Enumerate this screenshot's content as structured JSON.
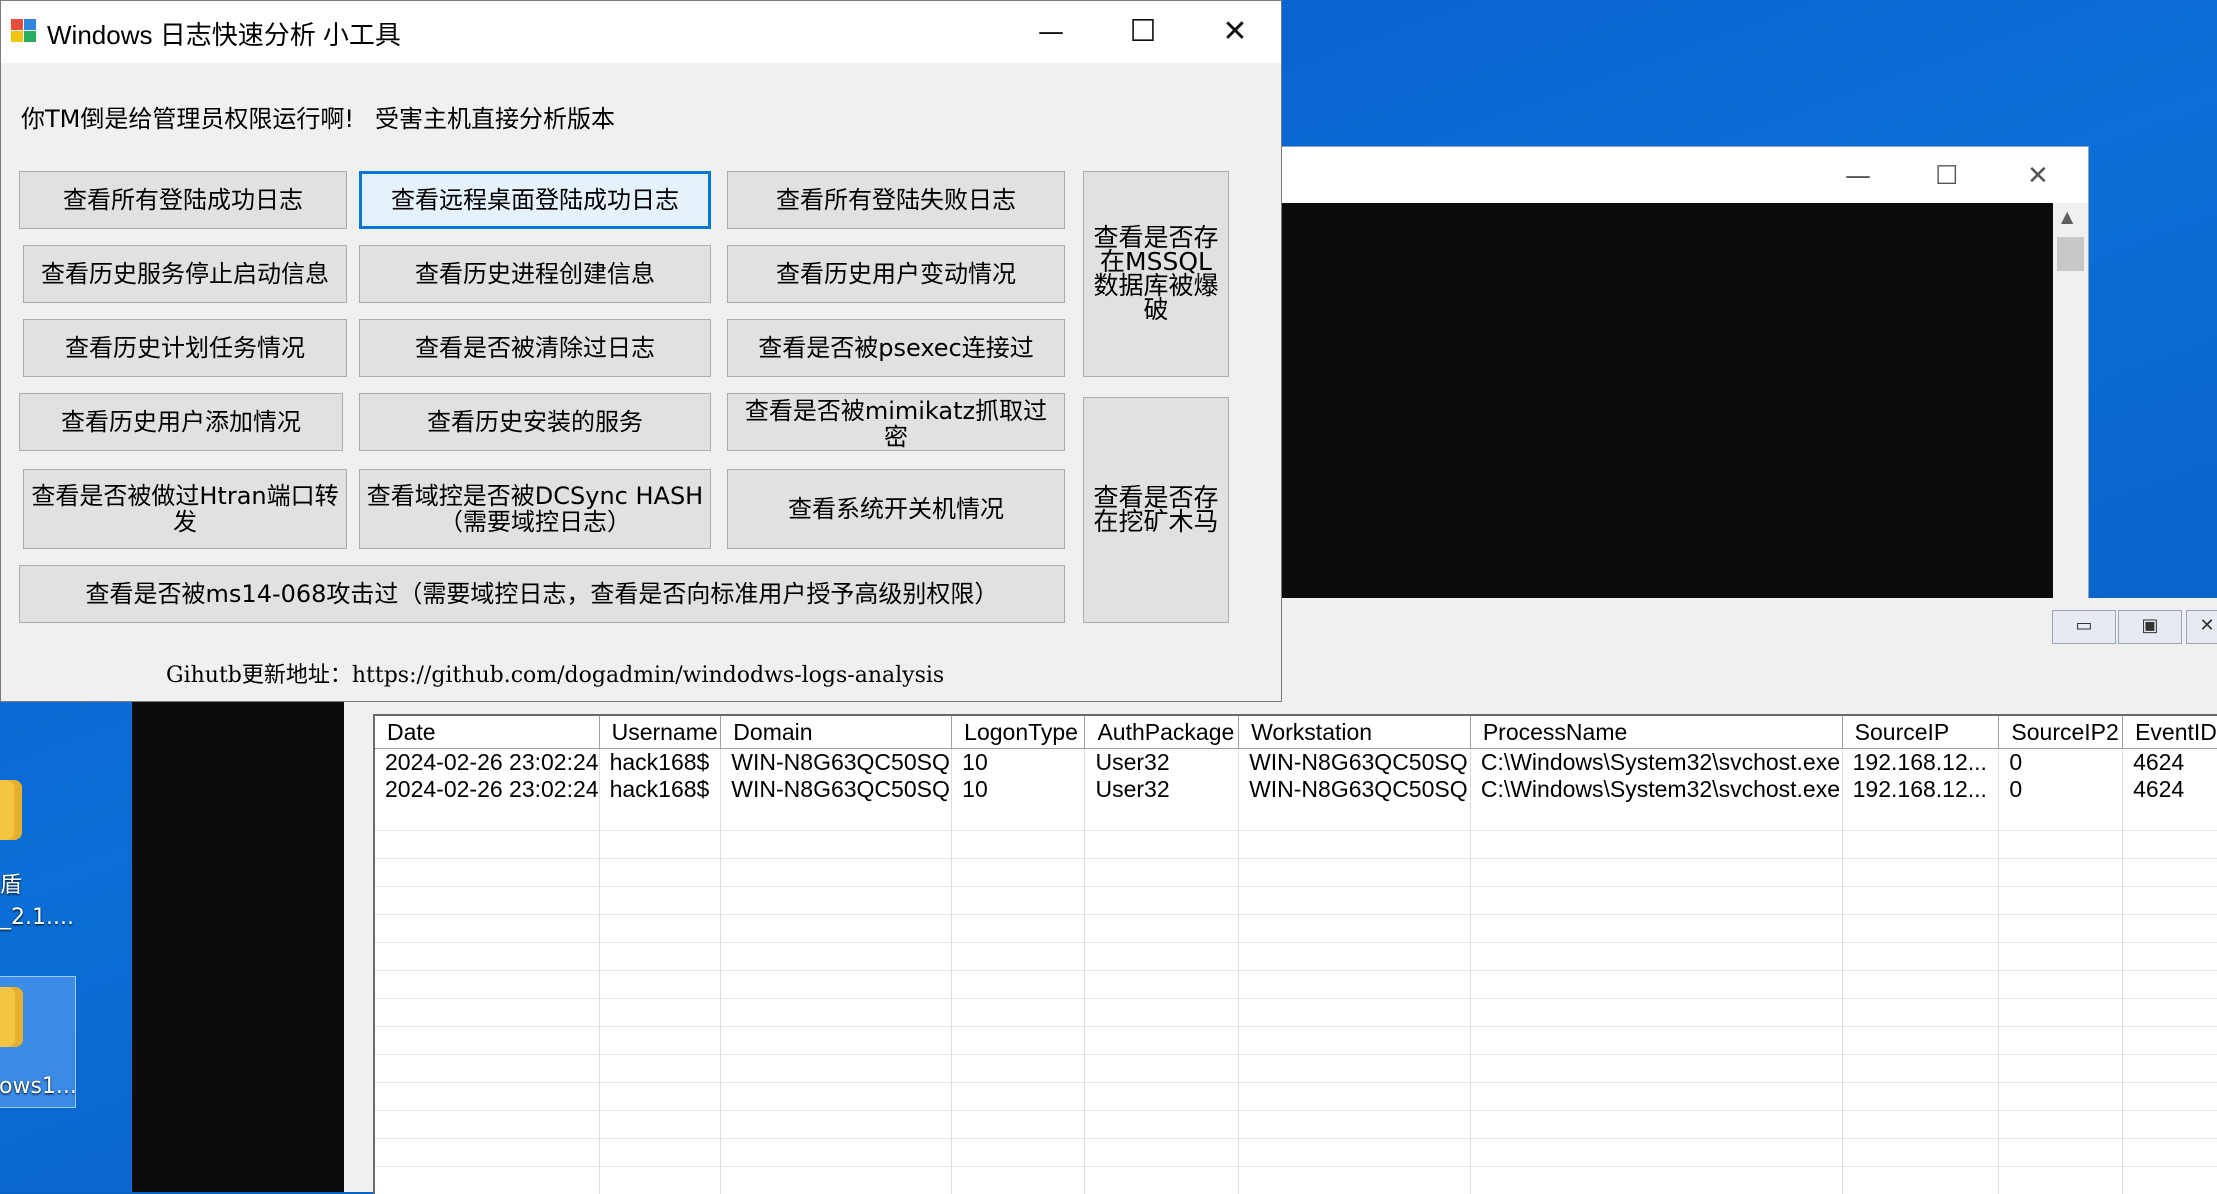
{
  "window": {
    "title": "Windows 日志快速分析 小工具",
    "minimize_glyph": "—",
    "maximize_glyph": "☐",
    "close_glyph": "✕"
  },
  "labels": {
    "admin_warning": "你TM倒是给管理员权限运行啊!",
    "version_note": "受害主机直接分析版本"
  },
  "buttons": {
    "all_logon_success": "查看所有登陆成功日志",
    "rdp_logon_success": "查看远程桌面登陆成功日志",
    "all_logon_failure": "查看所有登陆失败日志",
    "mssql_bruteforce": "查看是否存在MSSQL数据库被爆破",
    "service_history": "查看历史服务停止启动信息",
    "process_creation": "查看历史进程创建信息",
    "user_changes": "查看历史用户变动情况",
    "scheduled_tasks": "查看历史计划任务情况",
    "log_cleared": "查看是否被清除过日志",
    "psexec": "查看是否被psexec连接过",
    "user_added": "查看历史用户添加情况",
    "installed_services": "查看历史安装的服务",
    "mimikatz": "查看是否被mimikatz抓取过密",
    "mining_trojan": "查看是否存在挖矿木马",
    "htran": "查看是否被做过Htran端口转发",
    "dcsync": "查看域控是否被DCSync HASH（需要域控日志）",
    "shutdown_history": "查看系统开关机情况",
    "ms14_068": "查看是否被ms14-068攻击过（需要域控日志，查看是否向标准用户授予高级别权限）"
  },
  "github": "Gihutb更新地址：https://github.com/dogadmin/windodws-logs-analysis",
  "desktop": {
    "icon1_line1": "盾",
    "icon1_line2": "_2.1....",
    "icon2_label": "ows1..."
  },
  "console": {
    "minimize_glyph": "—",
    "maximize_glyph": "☐",
    "close_glyph": "✕",
    "scroll_up": "▲"
  },
  "mdi": {
    "b1": "▭",
    "b2": "▣",
    "b3": "✕"
  },
  "table": {
    "columns": [
      "Date",
      "Username",
      "Domain",
      "LogonType",
      "AuthPackage",
      "Workstation",
      "ProcessName",
      "SourceIP",
      "SourceIP2",
      "EventID"
    ],
    "rows": [
      [
        "2024-02-26 23:02:24",
        "hack168$",
        "WIN-N8G63QC50SQ",
        "10",
        "User32",
        "WIN-N8G63QC50SQ",
        "C:\\Windows\\System32\\svchost.exe",
        "192.168.12...",
        "0",
        "4624"
      ],
      [
        "2024-02-26 23:02:24",
        "hack168$",
        "WIN-N8G63QC50SQ",
        "10",
        "User32",
        "WIN-N8G63QC50SQ",
        "C:\\Windows\\System32\\svchost.exe",
        "192.168.12...",
        "0",
        "4624"
      ]
    ]
  }
}
